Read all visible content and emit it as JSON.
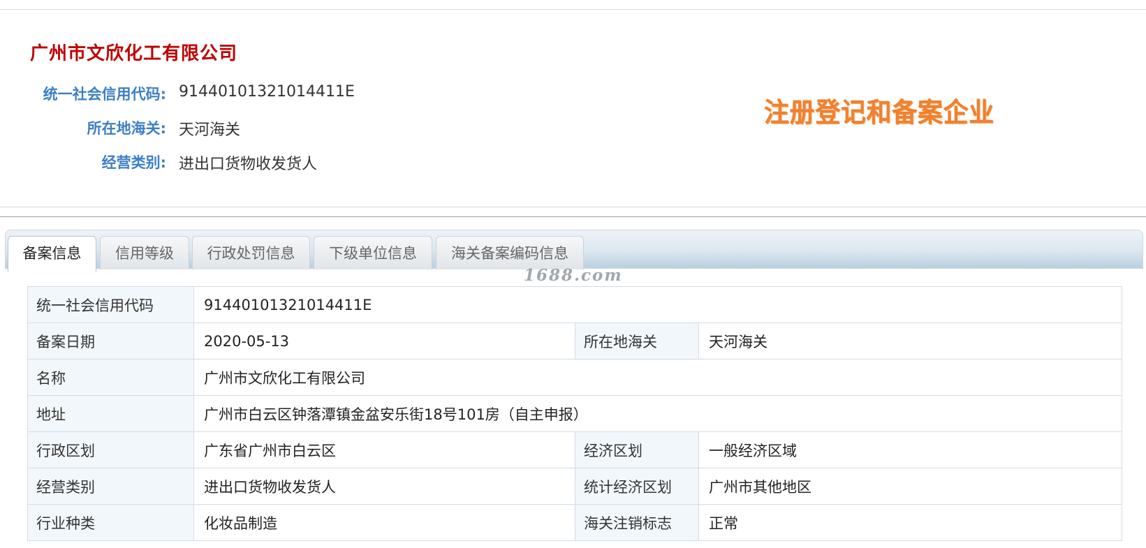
{
  "header": {
    "company_name": "广州市文欣化工有限公司",
    "fields": [
      {
        "label": "统一社会信用代码:",
        "value": "91440101321014411E"
      },
      {
        "label": "所在地海关:",
        "value": "天河海关"
      },
      {
        "label": "经营类别:",
        "value": "进出口货物收发货人"
      }
    ],
    "stamp_text": "注册登记和备案企业"
  },
  "tabs": [
    {
      "label": "备案信息",
      "active": true
    },
    {
      "label": "信用等级",
      "active": false
    },
    {
      "label": "行政处罚信息",
      "active": false
    },
    {
      "label": "下级单位信息",
      "active": false
    },
    {
      "label": "海关备案编码信息",
      "active": false
    }
  ],
  "watermark": "1688.com",
  "record": {
    "credit_code_label": "统一社会信用代码",
    "credit_code_value": "91440101321014411E",
    "filing_date_label": "备案日期",
    "filing_date_value": "2020-05-13",
    "customs_label": "所在地海关",
    "customs_value": "天河海关",
    "name_label": "名称",
    "name_value": "广州市文欣化工有限公司",
    "address_label": "地址",
    "address_value": "广州市白云区钟落潭镇金盆安乐街18号101房（自主申报）",
    "admin_region_label": "行政区划",
    "admin_region_value": "广东省广州市白云区",
    "econ_region_label": "经济区划",
    "econ_region_value": "一般经济区域",
    "business_type_label": "经营类别",
    "business_type_value": "进出口货物收发货人",
    "stat_region_label": "统计经济区划",
    "stat_region_value": "广州市其他地区",
    "industry_label": "行业种类",
    "industry_value": "化妆品制造",
    "cancel_flag_label": "海关注销标志",
    "cancel_flag_value": "正常"
  },
  "colors": {
    "title_red": "#c00000",
    "label_blue": "#3c7fc6",
    "stamp_orange": "#f08030",
    "table_border": "#d0dde7",
    "label_cell_bg": "#f2f7fb"
  }
}
